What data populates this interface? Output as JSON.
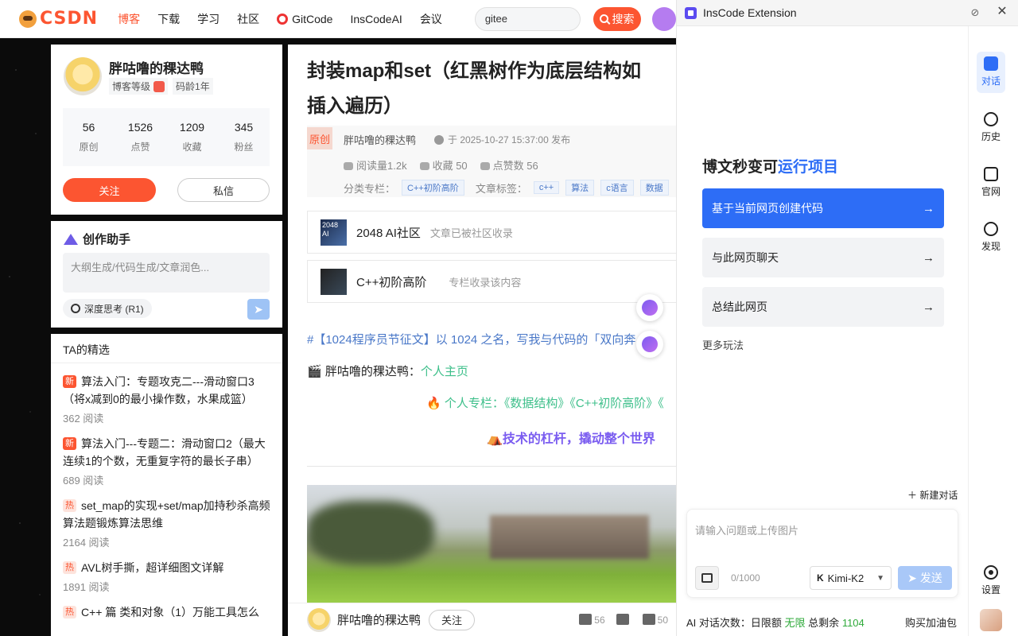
{
  "nav": {
    "brand": "CSDN",
    "items": [
      "博客",
      "下载",
      "学习",
      "社区"
    ],
    "gitcode": "GitCode",
    "inscode": "InsCodeAI",
    "meeting": "会议",
    "search_value": "gitee",
    "search_button": "搜索"
  },
  "profile": {
    "name": "胖咕噜的稞达鸭",
    "level_badge": "博客等级",
    "age_badge": "码龄1年",
    "stats": [
      {
        "num": "56",
        "label": "原创"
      },
      {
        "num": "1526",
        "label": "点赞"
      },
      {
        "num": "1209",
        "label": "收藏"
      },
      {
        "num": "345",
        "label": "粉丝"
      }
    ],
    "follow": "关注",
    "message": "私信"
  },
  "creator": {
    "title": "创作助手",
    "placeholder": "大纲生成/代码生成/文章润色...",
    "deep": "深度思考 (R1)"
  },
  "selected": {
    "title": "TA的精选",
    "items": [
      {
        "tag": "新",
        "title": "算法入门：专题攻克二---滑动窗口3（将x减到0的最小操作数，水果成篮）",
        "reads": "362 阅读"
      },
      {
        "tag": "新",
        "title": "算法入门---专题二：滑动窗口2（最大连续1的个数，无重复字符的最长子串）",
        "reads": "689 阅读"
      },
      {
        "tag": "热",
        "title": "set_map的实现+set/map加持秒杀高频算法题锻炼算法思维",
        "reads": "2164 阅读"
      },
      {
        "tag": "热",
        "title": "AVL树手撕，超详细图文详解",
        "reads": "1891 阅读"
      },
      {
        "tag": "热",
        "title": "C++ 篇 类和对象（1）万能工具怎么",
        "reads": ""
      }
    ]
  },
  "article": {
    "title_line1": "封装map和set（红黑树作为底层结构如",
    "title_line2": "插入遍历）",
    "original": "原创",
    "author": "胖咕噜的稞达鸭",
    "time": "于 2025-10-27 15:37:00 发布",
    "reads": "阅读量1.2k",
    "favs": "收藏 50",
    "likes": "点赞数 56",
    "cat_label": "分类专栏：",
    "cat": "C++初阶高阶",
    "tags_label": "文章标签：",
    "tags": [
      "c++",
      "算法",
      "c语言",
      "数据"
    ],
    "community1_name": "2048 AI社区",
    "community1_desc": "文章已被社区收录",
    "community2_name": "C++初阶高阶",
    "community2_desc": "专栏收录该内容",
    "line_event": "#【1024程序员节征文】以 1024 之名，写我与代码的「双向奔",
    "line_author_prefix": "🎬 胖咕噜的稞达鸭：",
    "line_author_link": "个人主页",
    "line_columns": "🔥 个人专栏：《数据结构》《C++初阶高阶》《",
    "line_motto": "⛺️技术的杠杆，撬动整个世界",
    "logo_img_label": "2048\nAI"
  },
  "bottombar": {
    "author": "胖咕噜的稞达鸭",
    "follow": "关注",
    "likes": "56",
    "favs": "50"
  },
  "ext": {
    "title": "InsCode Extension",
    "rail": [
      "对话",
      "历史",
      "官网",
      "发现"
    ],
    "settings": "设置",
    "promo_a": "博文秒变可",
    "promo_b": "运行项目",
    "actions": [
      "基于当前网页创建代码",
      "与此网页聊天",
      "总结此网页"
    ],
    "more": "更多玩法",
    "new_chat": "新建对话",
    "input_placeholder": "请输入问题或上传图片",
    "counter": "0/1000",
    "model": "Kimi-K2",
    "send": "发送",
    "quota_prefix": "AI 对话次数：日限额",
    "quota_unlimited": "无限",
    "quota_mid": "总剩余",
    "quota_left": "1104",
    "buy": "购买加油包"
  }
}
